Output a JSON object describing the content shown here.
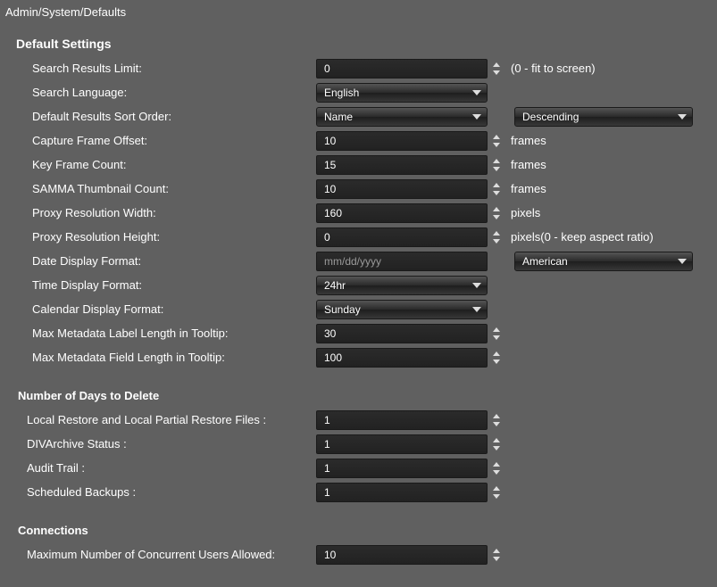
{
  "breadcrumb": "Admin/System/Defaults",
  "sections": {
    "default_settings_title": "Default Settings",
    "days_delete_title": "Number of Days to Delete",
    "connections_title": "Connections"
  },
  "labels": {
    "search_results_limit": "Search Results Limit:",
    "search_language": "Search Language:",
    "default_sort_order": "Default Results Sort Order:",
    "capture_frame_offset": "Capture Frame Offset:",
    "key_frame_count": "Key Frame Count:",
    "samma_thumb_count": "SAMMA Thumbnail Count:",
    "proxy_res_width": "Proxy Resolution Width:",
    "proxy_res_height": "Proxy Resolution Height:",
    "date_display_format": "Date Display Format:",
    "time_display_format": "Time Display Format:",
    "calendar_display_format": "Calendar Display Format:",
    "max_meta_label": "Max Metadata Label Length in Tooltip:",
    "max_meta_field": "Max Metadata Field Length in Tooltip:",
    "local_restore": "Local Restore and Local Partial Restore Files :",
    "divarchive_status": "DIVArchive Status :",
    "audit_trail": "Audit Trail :",
    "scheduled_backups": "Scheduled Backups :",
    "max_concurrent_users": "Maximum Number of Concurrent Users Allowed:"
  },
  "values": {
    "search_results_limit": "0",
    "search_language": "English",
    "default_sort_field": "Name",
    "default_sort_dir": "Descending",
    "capture_frame_offset": "10",
    "key_frame_count": "15",
    "samma_thumb_count": "10",
    "proxy_res_width": "160",
    "proxy_res_height": "0",
    "date_display_placeholder": "mm/dd/yyyy",
    "date_region": "American",
    "time_display_format": "24hr",
    "calendar_display_format": "Sunday",
    "max_meta_label": "30",
    "max_meta_field": "100",
    "local_restore": "1",
    "divarchive_status": "1",
    "audit_trail": "1",
    "scheduled_backups": "1",
    "max_concurrent_users": "10"
  },
  "suffixes": {
    "fit_to_screen": "(0 - fit to screen)",
    "frames": "frames",
    "pixels": "pixels",
    "pixels_keep_ratio": "pixels(0 - keep aspect ratio)"
  }
}
